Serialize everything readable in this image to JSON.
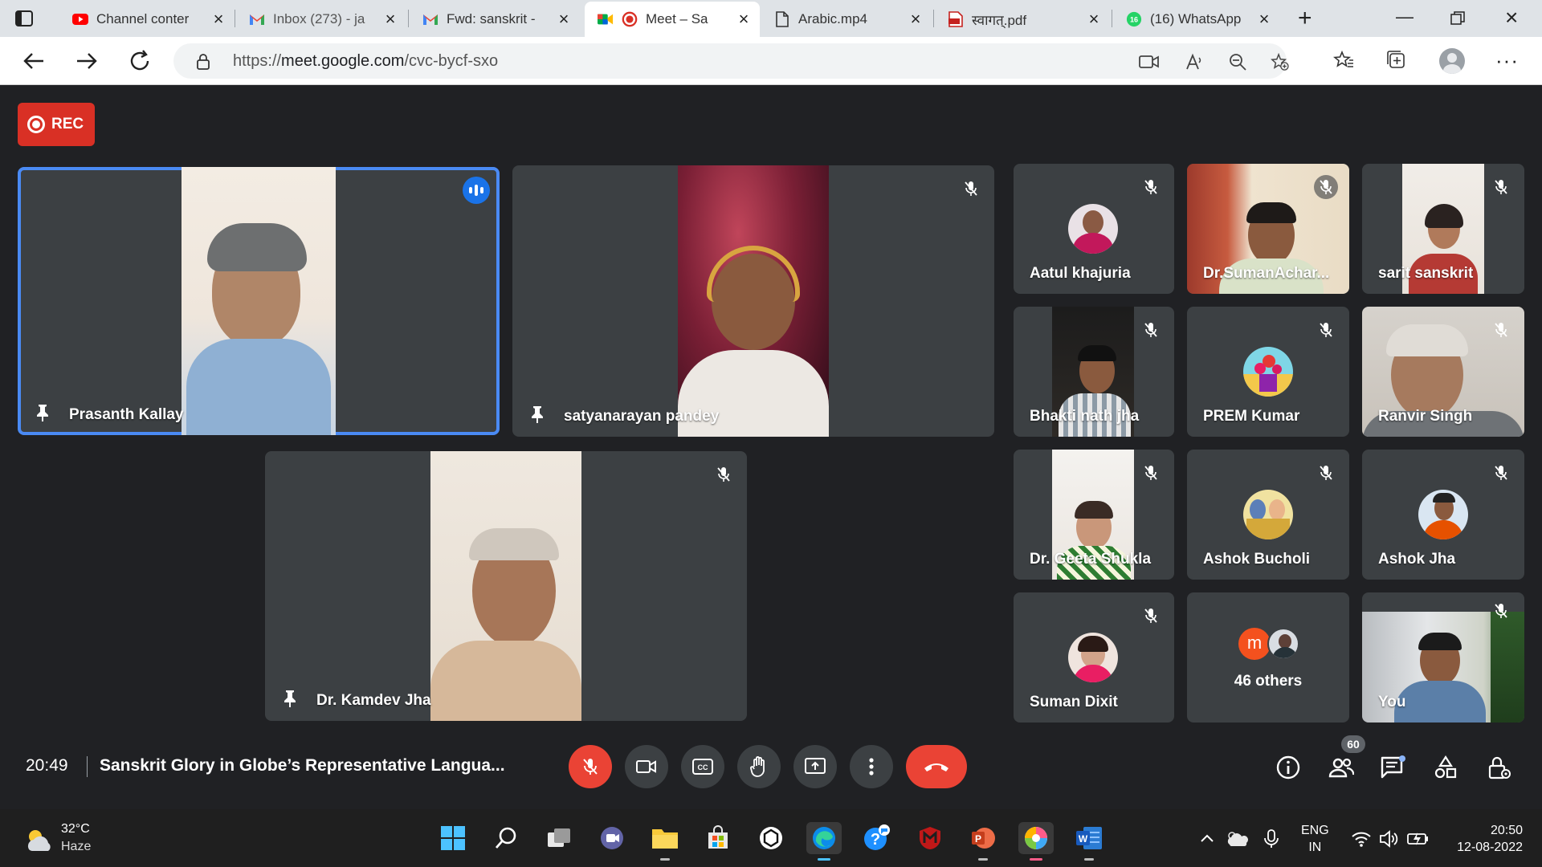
{
  "browser": {
    "tabs": [
      {
        "label": "Channel conter",
        "icon": "youtube-icon"
      },
      {
        "label": "Inbox (273) - ja",
        "icon": "gmail-icon"
      },
      {
        "label": "Fwd: sanskrit -",
        "icon": "gmail-icon"
      },
      {
        "label": "Meet – Sa",
        "icon": "meet-icon",
        "active": true
      },
      {
        "label": "Arabic.mp4",
        "icon": "file-icon"
      },
      {
        "label": "स्वागत्.pdf",
        "icon": "pdf-icon"
      },
      {
        "label": "(16) WhatsApp",
        "icon": "whatsapp-icon",
        "badge": "16"
      }
    ],
    "url_scheme": "https://",
    "url_host": "meet.google.com",
    "url_path": "/cvc-bycf-sxo"
  },
  "meet": {
    "rec_label": "REC",
    "main_tiles": [
      {
        "name": "Prasanth Kallay",
        "speaking": true
      },
      {
        "name": "satyanarayan pandey",
        "muted": true
      },
      {
        "name": "Dr. Kamdev Jha",
        "muted": true
      }
    ],
    "grid_tiles": [
      {
        "name": "Aatul khajuria"
      },
      {
        "name": "Dr.SumanAchar..."
      },
      {
        "name": "sarit sanskrit"
      },
      {
        "name": "Bhakti nath jha"
      },
      {
        "name": "PREM Kumar"
      },
      {
        "name": "Ranvir Singh"
      },
      {
        "name": "Dr. Geeta Shukla"
      },
      {
        "name": "Ashok Bucholi"
      },
      {
        "name": "Ashok Jha"
      },
      {
        "name": "Suman Dixit"
      },
      {
        "name": "46 others",
        "avatar_letter": "m"
      },
      {
        "name": "You"
      }
    ],
    "time": "20:49",
    "meeting_title": "Sanskrit Glory in Globe’s Representative Langua...",
    "participant_count": "60",
    "colors": {
      "accent": "#1a73e8",
      "danger": "#ea4335",
      "tile": "#3c4043",
      "background": "#202124"
    }
  },
  "taskbar": {
    "temperature": "32°C",
    "weather": "Haze",
    "lang_top": "ENG",
    "lang_bottom": "IN",
    "time": "20:50",
    "date": "12-08-2022"
  }
}
